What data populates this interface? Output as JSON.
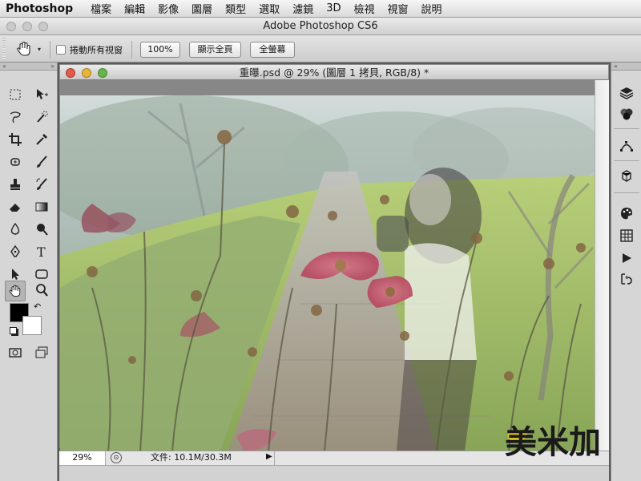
{
  "menubar": {
    "apple": "",
    "app_name": "Photoshop",
    "items": [
      "檔案",
      "編輯",
      "影像",
      "圖層",
      "類型",
      "選取",
      "濾鏡",
      "3D",
      "檢視",
      "視窗",
      "說明"
    ]
  },
  "window": {
    "title": "Adobe Photoshop CS6"
  },
  "options": {
    "scroll_all_label": "捲動所有視窗",
    "zoom_btn": "100%",
    "fit_btn": "顯示全頁",
    "fill_btn": "全螢幕"
  },
  "document": {
    "title": "重曝.psd @ 29% (圖層 1 拷貝, RGB/8) *",
    "zoom": "29%",
    "file_info": "文件: 10.1M/30.3M"
  },
  "watermark": "美米加",
  "colors": {
    "foreground": "#000000",
    "background": "#ffffff",
    "close": "#e35b4f",
    "minimize": "#e9b43a",
    "maximize": "#6ab34a"
  },
  "icons": {
    "left_tools": [
      "marquee-icon",
      "move-icon",
      "lasso-icon",
      "quick-selection-icon",
      "crop-icon",
      "eyedropper-icon",
      "spot-heal-icon",
      "brush-icon",
      "clone-stamp-icon",
      "history-brush-icon",
      "eraser-icon",
      "gradient-icon",
      "blur-icon",
      "dodge-icon",
      "pen-icon",
      "type-icon",
      "path-select-icon",
      "shape-icon",
      "hand-icon",
      "zoom-icon"
    ],
    "right_tools": [
      "layers-icon",
      "channels-icon",
      "paths-icon",
      "3d-icon",
      "swatches-icon",
      "grid-icon",
      "actions-icon",
      "history-icon"
    ]
  }
}
